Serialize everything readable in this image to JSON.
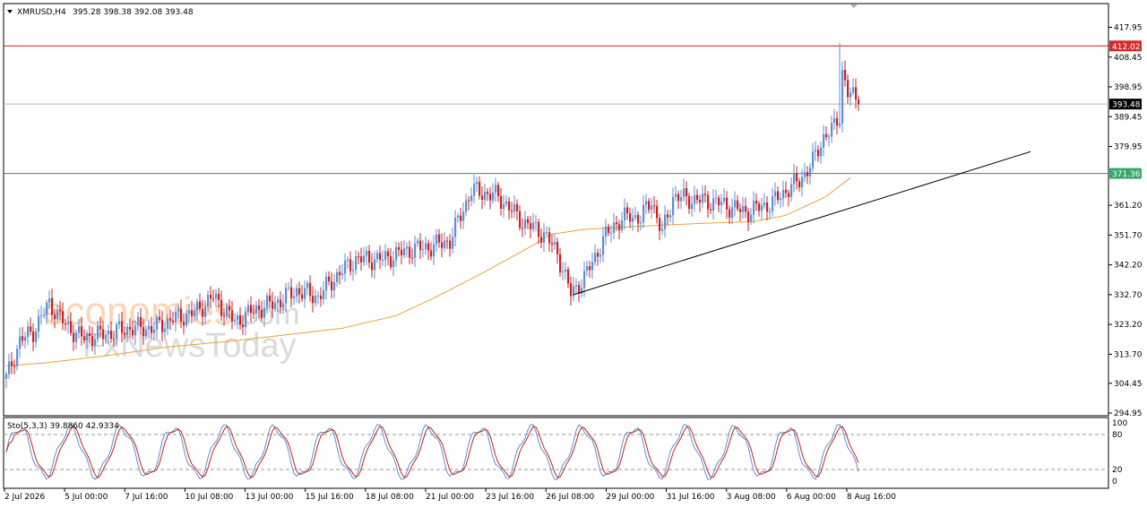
{
  "header": {
    "symbol_label": "XMRUSD,H4",
    "ohlc_label": "395.28 398.38 392.08 393.48"
  },
  "watermark": {
    "line1": "economies",
    "line1_suffix": ".com",
    "line2": "FxNewsToday"
  },
  "colors": {
    "bull": "#5b8fd6",
    "bear": "#cc1f1f",
    "ma": "#e8a33a",
    "resistance": "#cc1f1f",
    "support": "#2e8b57",
    "trend": "#000000",
    "stoch_k": "#5b8fd6",
    "stoch_d": "#cc1f1f"
  },
  "price_axis": {
    "ticks": [
      "417.95",
      "408.45",
      "398.95",
      "389.45",
      "379.95",
      "371.36",
      "361.20",
      "351.70",
      "342.20",
      "332.70",
      "323.20",
      "313.70",
      "304.45",
      "294.95"
    ]
  },
  "levels": {
    "resistance": {
      "value": 412.02,
      "label": "412.02"
    },
    "current": {
      "value": 393.48,
      "label": "393.48"
    },
    "support": {
      "value": 371.36,
      "label": "371.36"
    }
  },
  "stochastic": {
    "label": "Sto(5,3,3) 39.8860 42.9334",
    "ticks": [
      "100",
      "80",
      "20",
      "0"
    ],
    "levels": [
      80,
      20
    ]
  },
  "time_axis": {
    "labels": [
      "2 Jul 2026",
      "5 Jul 00:00",
      "7 Jul 16:00",
      "10 Jul 08:00",
      "13 Jul 00:00",
      "15 Jul 16:00",
      "18 Jul 08:00",
      "21 Jul 00:00",
      "23 Jul 16:00",
      "26 Jul 08:00",
      "29 Jul 00:00",
      "31 Jul 16:00",
      "3 Aug 08:00",
      "6 Aug 00:00",
      "8 Aug 16:00"
    ]
  },
  "chart_data": {
    "type": "candlestick",
    "symbol": "XMRUSD",
    "timeframe": "H4",
    "ylim": [
      294.95,
      421
    ],
    "moving_average": [
      [
        0,
        310
      ],
      [
        15,
        311
      ],
      [
        35,
        313
      ],
      [
        60,
        316
      ],
      [
        85,
        318
      ],
      [
        105,
        320
      ],
      [
        125,
        322
      ],
      [
        145,
        326
      ],
      [
        160,
        332
      ],
      [
        178,
        340
      ],
      [
        195,
        348
      ],
      [
        203,
        352
      ],
      [
        215,
        353.5
      ],
      [
        235,
        354.5
      ],
      [
        260,
        355.5
      ],
      [
        278,
        356
      ],
      [
        290,
        358
      ],
      [
        305,
        364
      ],
      [
        314,
        370
      ]
    ],
    "trend_line": {
      "start": [
        211,
        332.7
      ],
      "end": [
        381,
        378.3
      ]
    },
    "price_anchors": [
      [
        0,
        306
      ],
      [
        5,
        318
      ],
      [
        10,
        321
      ],
      [
        16,
        330
      ],
      [
        22,
        323
      ],
      [
        28,
        319
      ],
      [
        36,
        320
      ],
      [
        46,
        322
      ],
      [
        55,
        322
      ],
      [
        62,
        325
      ],
      [
        70,
        327
      ],
      [
        77,
        332
      ],
      [
        85,
        324
      ],
      [
        93,
        328
      ],
      [
        100,
        330
      ],
      [
        108,
        334
      ],
      [
        116,
        332
      ],
      [
        122,
        338
      ],
      [
        130,
        344
      ],
      [
        140,
        344
      ],
      [
        150,
        347
      ],
      [
        158,
        348
      ],
      [
        165,
        350
      ],
      [
        173,
        366
      ],
      [
        183,
        364
      ],
      [
        192,
        356
      ],
      [
        200,
        352
      ],
      [
        205,
        346
      ],
      [
        210,
        333
      ],
      [
        215,
        338
      ],
      [
        222,
        350
      ],
      [
        226,
        355
      ],
      [
        232,
        358
      ],
      [
        236,
        357
      ],
      [
        240,
        363
      ],
      [
        244,
        352
      ],
      [
        248,
        364
      ],
      [
        256,
        363
      ],
      [
        265,
        362
      ],
      [
        275,
        359
      ],
      [
        285,
        362
      ],
      [
        290,
        366
      ],
      [
        295,
        369
      ],
      [
        300,
        375
      ],
      [
        304,
        383
      ],
      [
        308,
        386
      ],
      [
        310,
        390
      ],
      [
        311,
        404
      ],
      [
        313,
        397
      ],
      [
        316,
        395
      ],
      [
        317,
        393.48
      ]
    ],
    "spike": {
      "x": 310,
      "high": 413,
      "low": 395
    }
  }
}
